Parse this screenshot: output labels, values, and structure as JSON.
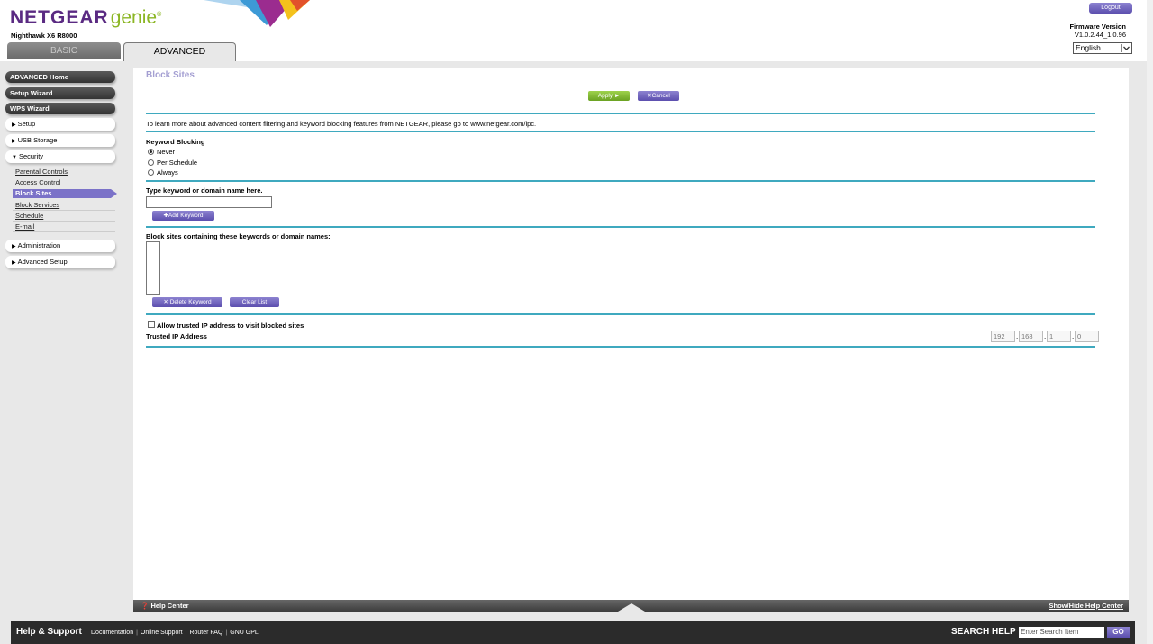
{
  "header": {
    "logo_netgear": "NETGEAR",
    "logo_genie": "genie",
    "logo_tm": "®",
    "model": "Nighthawk X6 R8000",
    "logout": "Logout",
    "firmware_label": "Firmware Version",
    "firmware_value": "V1.0.2.44_1.0.96",
    "language": "English"
  },
  "tabs": {
    "basic": "BASIC",
    "advanced": "ADVANCED"
  },
  "sidebar": {
    "advanced_home": "ADVANCED Home",
    "setup_wizard": "Setup Wizard",
    "wps_wizard": "WPS Wizard",
    "setup": "Setup",
    "usb_storage": "USB Storage",
    "security": "Security",
    "security_items": {
      "parental_controls": "Parental Controls",
      "access_control": "Access Control",
      "block_sites": "Block Sites",
      "block_services": "Block Services",
      "schedule": "Schedule",
      "email": "E-mail"
    },
    "administration": "Administration",
    "advanced_setup": "Advanced Setup"
  },
  "main": {
    "title": "Block Sites",
    "apply": "Apply ►",
    "cancel": "Cancel",
    "info_text": "To learn more about advanced content filtering and keyword blocking features from NETGEAR, please go to www.netgear.com/lpc.",
    "keyword_blocking_label": "Keyword Blocking",
    "radio_options": {
      "never": "Never",
      "per_schedule": "Per Schedule",
      "always": "Always"
    },
    "selected_option": "Never",
    "type_keyword_label": "Type keyword or domain name here.",
    "keyword_input_value": "",
    "add_keyword": "Add Keyword",
    "block_list_label": "Block sites containing these keywords or domain names:",
    "delete_keyword": "Delete Keyword",
    "clear_list": "Clear List",
    "allow_trusted_label": "Allow trusted IP address to visit blocked sites",
    "trusted_ip_label": "Trusted IP Address",
    "trusted_ip": {
      "o1": "192",
      "o2": "168",
      "o3": "1",
      "o4": "0"
    }
  },
  "help_center": {
    "label": "Help Center",
    "toggle": "Show/Hide Help Center"
  },
  "footer": {
    "title": "Help & Support",
    "links": {
      "documentation": "Documentation",
      "online_support": "Online Support",
      "router_faq": "Router FAQ",
      "gnu_gpl": "GNU GPL"
    },
    "search_label": "SEARCH HELP",
    "search_placeholder": "Enter Search Item",
    "go": "GO"
  },
  "colors": {
    "accent_purple": "#6b60bd",
    "apply_green": "#7db834",
    "rule_teal": "#3fa9bf",
    "logo_purple": "#5a2a82"
  }
}
